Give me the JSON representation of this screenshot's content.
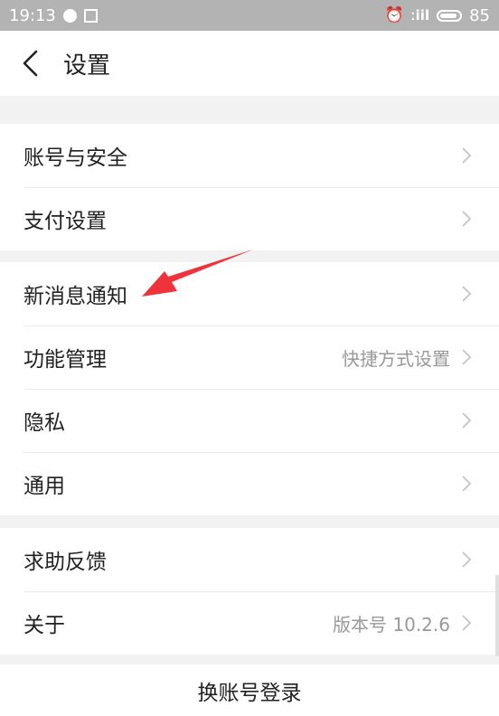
{
  "status_bar": {
    "time": "19:13",
    "signal": "ːiil",
    "battery": "85"
  },
  "header": {
    "title": "设置"
  },
  "groups": [
    [
      {
        "label": "账号与安全",
        "value": ""
      },
      {
        "label": "支付设置",
        "value": ""
      }
    ],
    [
      {
        "label": "新消息通知",
        "value": ""
      },
      {
        "label": "功能管理",
        "value": "快捷方式设置"
      },
      {
        "label": "隐私",
        "value": ""
      },
      {
        "label": "通用",
        "value": ""
      }
    ],
    [
      {
        "label": "求助反馈",
        "value": ""
      },
      {
        "label": "关于",
        "value": "版本号 10.2.6"
      }
    ]
  ],
  "footer": {
    "switch_account": "换账号登录"
  },
  "colors": {
    "status_bar": "#b3b3b3",
    "annotation_arrow": "#f0323a"
  }
}
